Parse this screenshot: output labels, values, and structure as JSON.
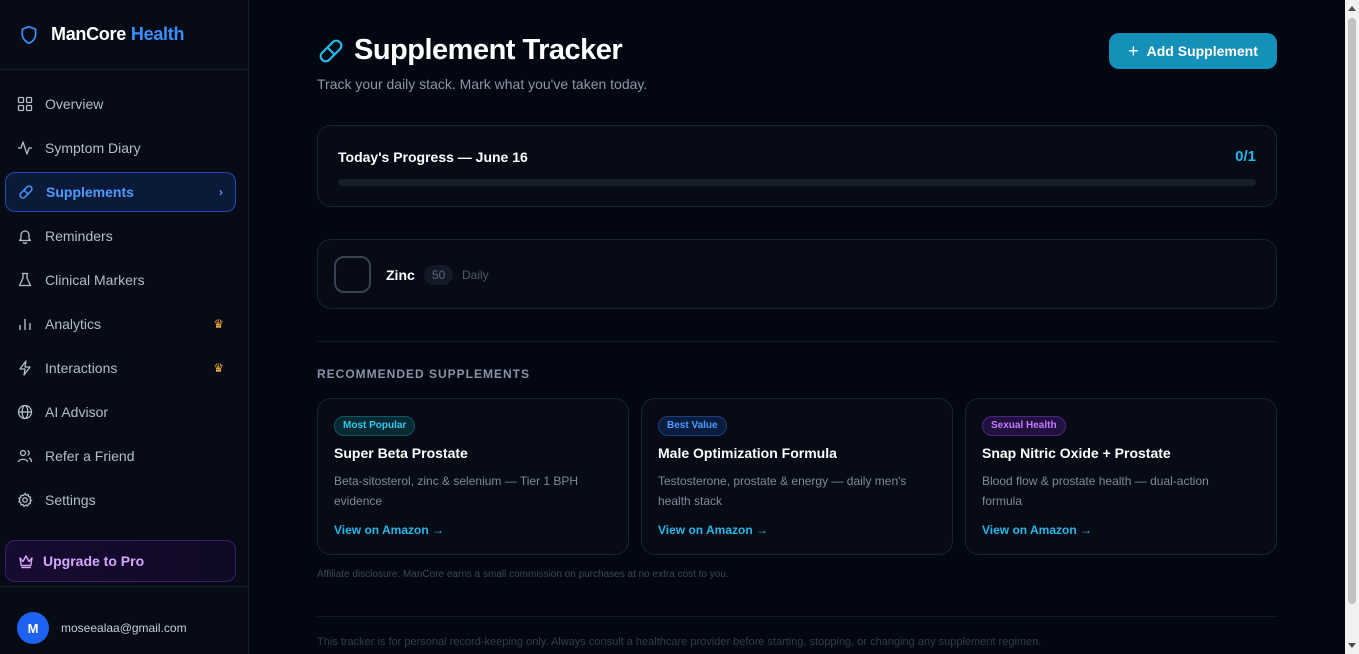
{
  "brand": {
    "name": "ManCore",
    "accent": "Health"
  },
  "sidebar": {
    "items": [
      {
        "label": "Overview",
        "icon": "grid-icon"
      },
      {
        "label": "Symptom Diary",
        "icon": "activity-icon"
      },
      {
        "label": "Supplements",
        "icon": "pill-icon",
        "active": true
      },
      {
        "label": "Reminders",
        "icon": "bell-icon"
      },
      {
        "label": "Clinical Markers",
        "icon": "flask-icon"
      },
      {
        "label": "Analytics",
        "icon": "bar-chart-icon",
        "pro": true
      },
      {
        "label": "Interactions",
        "icon": "lightning-icon",
        "pro": true
      },
      {
        "label": "AI Advisor",
        "icon": "globe-icon"
      },
      {
        "label": "Refer a Friend",
        "icon": "users-icon"
      },
      {
        "label": "Settings",
        "icon": "gear-icon"
      }
    ],
    "upgrade_label": "Upgrade to Pro",
    "user": {
      "initial": "M",
      "email": "moseealaa@gmail.com"
    }
  },
  "page": {
    "title": "Supplement Tracker",
    "subtitle": "Track your daily stack. Mark what you've taken today.",
    "add_button": "Add Supplement"
  },
  "progress": {
    "label": "Today's Progress — June 16",
    "count": "0/1",
    "fraction": 0
  },
  "supplements": [
    {
      "name": "Zinc",
      "dose": "50",
      "frequency": "Daily",
      "taken": false
    }
  ],
  "recommended": {
    "heading": "RECOMMENDED SUPPLEMENTS",
    "items": [
      {
        "badge": "Most Popular",
        "title": "Super Beta Prostate",
        "description": "Beta-sitosterol, zinc & selenium — Tier 1 BPH evidence",
        "link": "View on Amazon →"
      },
      {
        "badge": "Best Value",
        "title": "Male Optimization Formula",
        "description": "Testosterone, prostate & energy — daily men's health stack",
        "link": "View on Amazon →"
      },
      {
        "badge": "Sexual Health",
        "title": "Snap Nitric Oxide + Prostate",
        "description": "Blood flow & prostate health — dual-action formula",
        "link": "View on Amazon →"
      }
    ],
    "disclosure": "Affiliate disclosure: ManCore earns a small commission on purchases at no extra cost to you."
  },
  "footer_note": "This tracker is for personal record-keeping only. Always consult a healthcare provider before starting, stopping, or changing any supplement regimen.",
  "colors": {
    "accent": "#27b7e8",
    "brand_blue": "#3b8eff",
    "pro_purple": "#d6a5ff",
    "crown": "#f0a93a"
  }
}
